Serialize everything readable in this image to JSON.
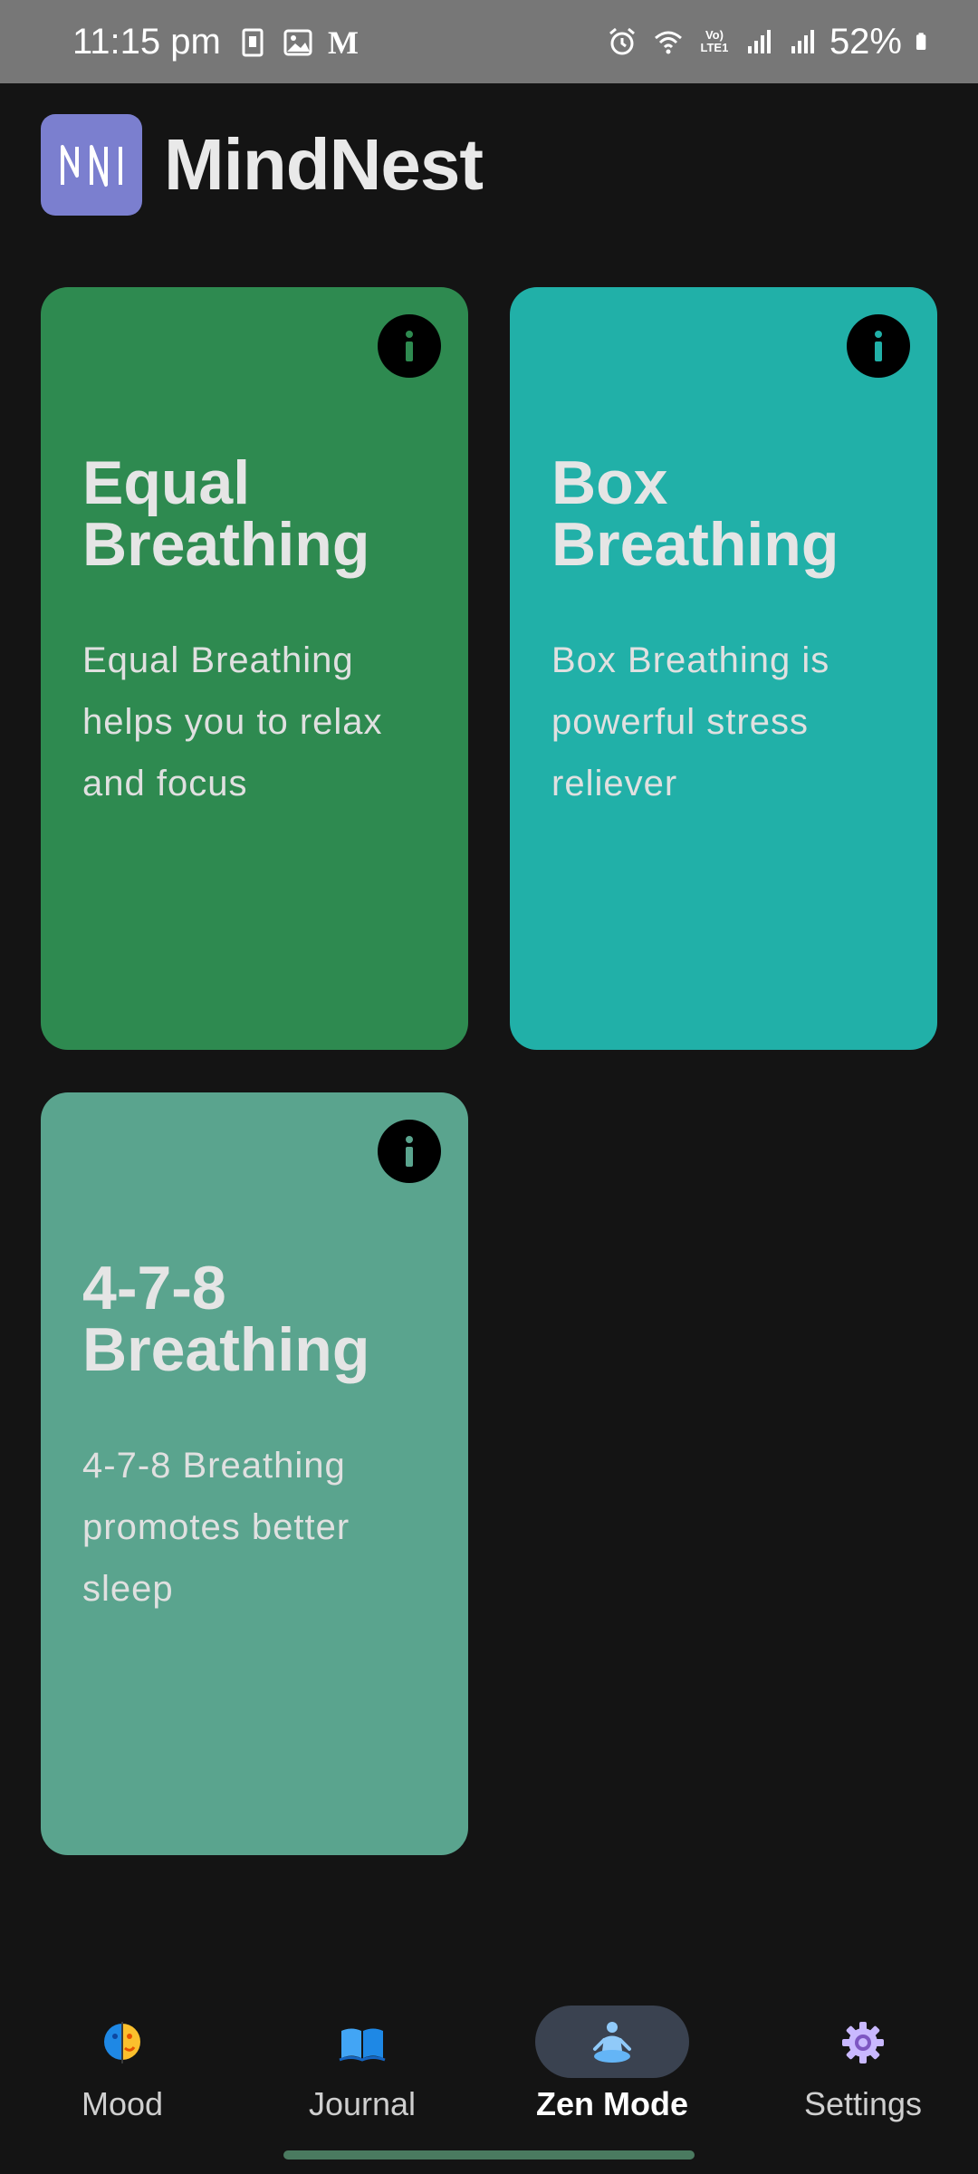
{
  "status_bar": {
    "time": "11:15 pm",
    "notification_text": "M",
    "battery": "52%",
    "network": "Vo) LTE1"
  },
  "app": {
    "logo_text": "MN",
    "title": "MindNest"
  },
  "cards": [
    {
      "title_line1": "Equal",
      "title_line2": "Breathing",
      "description": "Equal Breathing helps you to relax and focus",
      "color": "#2e8a50",
      "info_icon": "info-icon"
    },
    {
      "title_line1": "Box",
      "title_line2": "Breathing",
      "description": "Box Breathing is powerful stress reliever",
      "color": "#21b0a8",
      "info_icon": "info-icon"
    },
    {
      "title_line1": "4-7-8",
      "title_line2": "Breathing",
      "description": "4-7-8 Breathing promotes better sleep",
      "color": "#5aa48e",
      "info_icon": "info-icon"
    }
  ],
  "bottom_nav": {
    "items": [
      {
        "label": "Mood",
        "icon": "mood-face-icon",
        "active": false
      },
      {
        "label": "Journal",
        "icon": "open-book-icon",
        "active": false
      },
      {
        "label": "Zen Mode",
        "icon": "meditation-icon",
        "active": true
      },
      {
        "label": "Settings",
        "icon": "gear-icon",
        "active": false
      }
    ]
  },
  "colors": {
    "background": "#141414",
    "accent_logo": "#7b7fcf",
    "active_nav_pill": "#3a4250"
  }
}
